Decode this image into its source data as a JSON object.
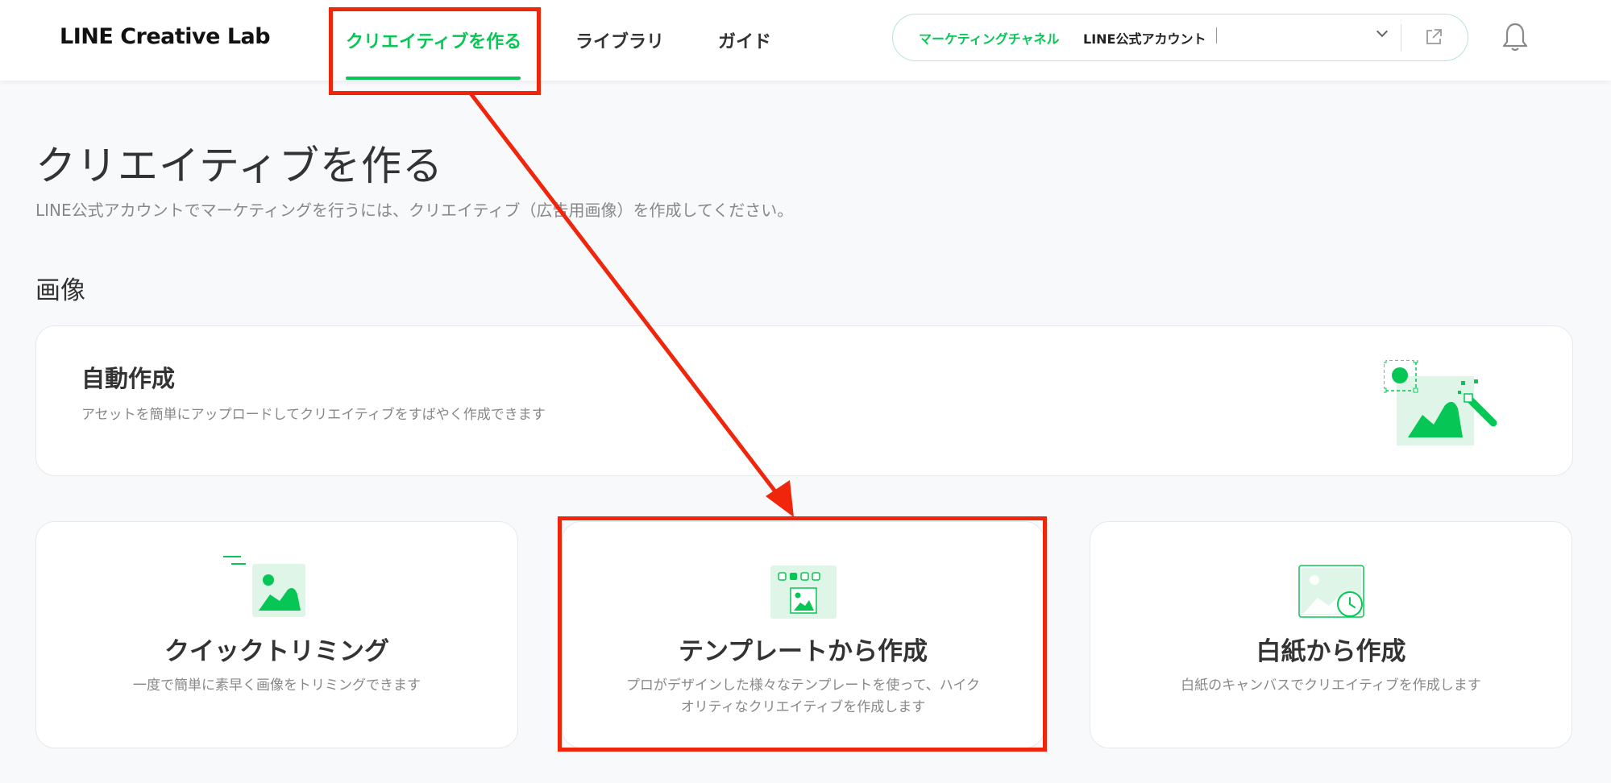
{
  "header": {
    "logo": "LINE Creative Lab",
    "nav": [
      {
        "label": "クリエイティブを作る",
        "active": true
      },
      {
        "label": "ライブラリ",
        "active": false
      },
      {
        "label": "ガイド",
        "active": false
      }
    ],
    "channel": {
      "label": "マーケティングチャネル",
      "value": "LINE公式アカウント"
    },
    "icons": {
      "external": "external-link-icon",
      "notifications": "bell-icon"
    }
  },
  "page": {
    "title": "クリエイティブを作る",
    "subtitle": "LINE公式アカウントでマーケティングを行うには、クリエイティブ（広告用画像）を作成してください。",
    "section_title": "画像"
  },
  "cards": {
    "auto": {
      "title": "自動作成",
      "desc": "アセットを簡単にアップロードしてクリエイティブをすばやく作成できます",
      "icon": "magic-image-icon"
    },
    "quick": {
      "title": "クイックトリミング",
      "desc": "一度で簡単に素早く画像をトリミングできます",
      "icon": "quick-image-icon"
    },
    "template": {
      "title": "テンプレートから作成",
      "desc_line1": "プロがデザインした様々なテンプレートを使って、ハイク",
      "desc_line2": "オリティなクリエイティブを作成します",
      "icon": "template-icon"
    },
    "blank": {
      "title": "白紙から作成",
      "desc": "白紙のキャンバスでクリエイティブを作成します",
      "icon": "blank-canvas-icon"
    }
  },
  "colors": {
    "accent": "#06c755",
    "annotation": "#f0260c",
    "icon_bg": "#dff5e7"
  }
}
